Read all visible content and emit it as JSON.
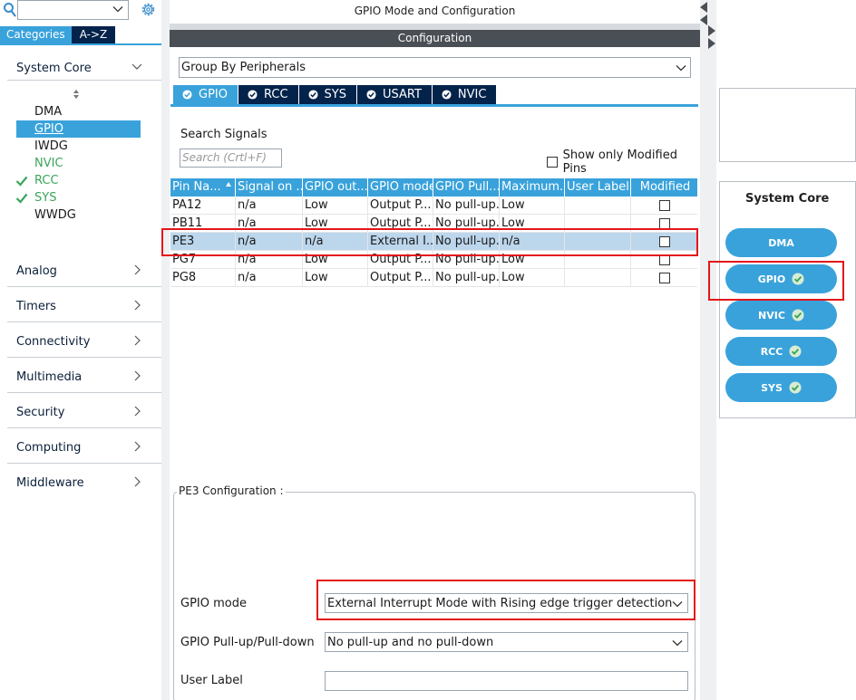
{
  "left": {
    "tabs": [
      {
        "label": "Categories",
        "active": true
      },
      {
        "label": "A->Z",
        "active": false
      }
    ],
    "system_core": {
      "label": "System Core",
      "peripherals": [
        {
          "label": "DMA",
          "state": "normal"
        },
        {
          "label": "GPIO",
          "state": "selected"
        },
        {
          "label": "IWDG",
          "state": "normal"
        },
        {
          "label": "NVIC",
          "state": "green"
        },
        {
          "label": "RCC",
          "state": "checked"
        },
        {
          "label": "SYS",
          "state": "checked"
        },
        {
          "label": "WWDG",
          "state": "normal"
        }
      ]
    },
    "sections": [
      "Analog",
      "Timers",
      "Connectivity",
      "Multimedia",
      "Security",
      "Computing",
      "Middleware"
    ]
  },
  "center": {
    "title": "GPIO Mode and Configuration",
    "config_header": "Configuration",
    "group_by": "Group By Peripherals",
    "tabs": [
      {
        "label": "GPIO",
        "active": true
      },
      {
        "label": "RCC",
        "active": false
      },
      {
        "label": "SYS",
        "active": false
      },
      {
        "label": "USART",
        "active": false
      },
      {
        "label": "NVIC",
        "active": false
      }
    ],
    "search_label": "Search Signals",
    "search_placeholder": "Search (Crtl+F)",
    "show_modified": "Show only Modified Pins",
    "table": {
      "columns": [
        "Pin Na...",
        "Signal on ...",
        "GPIO out...",
        "GPIO mode",
        "GPIO Pull...",
        "Maximum...",
        "User Label",
        "Modified"
      ],
      "rows": [
        [
          "PA12",
          "n/a",
          "Low",
          "Output P...",
          "No pull-up...",
          "Low",
          ""
        ],
        [
          "PB11",
          "n/a",
          "Low",
          "Output P...",
          "No pull-up...",
          "Low",
          ""
        ],
        [
          "PE3",
          "n/a",
          "n/a",
          "External I...",
          "No pull-up...",
          "n/a",
          ""
        ],
        [
          "PG7",
          "n/a",
          "Low",
          "Output P...",
          "No pull-up...",
          "Low",
          ""
        ],
        [
          "PG8",
          "n/a",
          "Low",
          "Output P...",
          "No pull-up...",
          "Low",
          ""
        ]
      ],
      "selected_row": 2
    },
    "pin_config": {
      "title": "PE3 Configuration :",
      "gpio_mode_label": "GPIO mode",
      "gpio_mode_value": "External Interrupt Mode with Rising edge trigger detection",
      "pull_label": "GPIO Pull-up/Pull-down",
      "pull_value": "No pull-up and no pull-down",
      "user_label_label": "User Label",
      "user_label_value": ""
    }
  },
  "right": {
    "title": "System Core",
    "buttons": [
      {
        "label": "DMA",
        "checked": false
      },
      {
        "label": "GPIO",
        "checked": true
      },
      {
        "label": "NVIC",
        "checked": true
      },
      {
        "label": "RCC",
        "checked": true
      },
      {
        "label": "SYS",
        "checked": true
      }
    ]
  },
  "colors": {
    "accent": "#39a2db",
    "dark_navy": "#03234b",
    "highlight_red": "#e3161b",
    "check_green": "#3aa55b",
    "selected_row": "#bcd6ec"
  },
  "icons": [
    "search-icon",
    "chevron-down-icon",
    "gear-icon",
    "chevron-right-icon",
    "check-icon",
    "sort-icon",
    "collapse-arrow-icon"
  ]
}
